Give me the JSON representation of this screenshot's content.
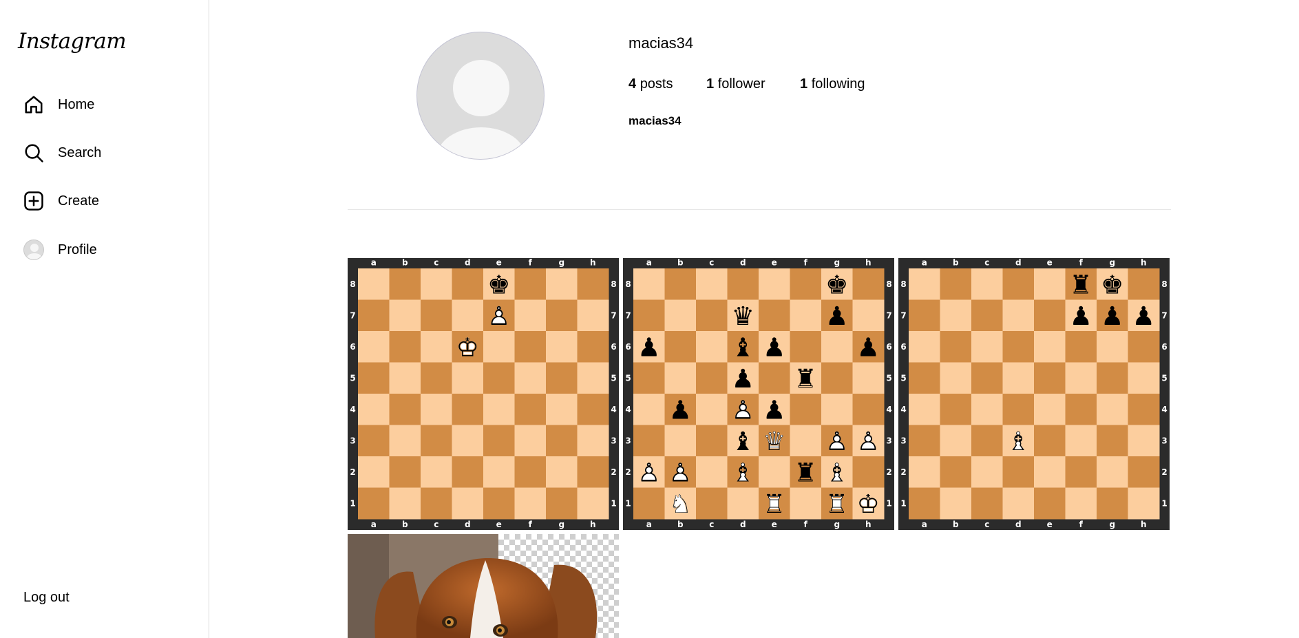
{
  "sidebar": {
    "logo": "Instagram",
    "items": [
      {
        "label": "Home",
        "icon": "home-icon"
      },
      {
        "label": "Search",
        "icon": "search-icon"
      },
      {
        "label": "Create",
        "icon": "plus-square-icon"
      },
      {
        "label": "Profile",
        "icon": "avatar"
      }
    ],
    "logout": "Log out"
  },
  "profile": {
    "username": "macias34",
    "posts_count": "4",
    "posts_label": "posts",
    "followers_count": "1",
    "followers_label": "follower",
    "following_count": "1",
    "following_label": "following",
    "full_name": "macias34"
  },
  "posts": [
    {
      "type": "chess-board",
      "files": [
        "a",
        "b",
        "c",
        "d",
        "e",
        "f",
        "g",
        "h"
      ],
      "ranks": [
        "8",
        "7",
        "6",
        "5",
        "4",
        "3",
        "2",
        "1"
      ],
      "pieces": [
        {
          "square": "e8",
          "piece": "k"
        },
        {
          "square": "e7",
          "piece": "P"
        },
        {
          "square": "d6",
          "piece": "K"
        }
      ]
    },
    {
      "type": "chess-board",
      "files": [
        "a",
        "b",
        "c",
        "d",
        "e",
        "f",
        "g",
        "h"
      ],
      "ranks": [
        "8",
        "7",
        "6",
        "5",
        "4",
        "3",
        "2",
        "1"
      ],
      "pieces": [
        {
          "square": "g8",
          "piece": "k"
        },
        {
          "square": "d7",
          "piece": "q"
        },
        {
          "square": "g7",
          "piece": "p"
        },
        {
          "square": "a6",
          "piece": "p"
        },
        {
          "square": "d6",
          "piece": "b"
        },
        {
          "square": "e6",
          "piece": "p"
        },
        {
          "square": "h6",
          "piece": "p"
        },
        {
          "square": "d5",
          "piece": "p"
        },
        {
          "square": "f5",
          "piece": "r"
        },
        {
          "square": "b4",
          "piece": "p"
        },
        {
          "square": "d4",
          "piece": "P"
        },
        {
          "square": "e4",
          "piece": "p"
        },
        {
          "square": "d3",
          "piece": "b"
        },
        {
          "square": "e3",
          "piece": "Q"
        },
        {
          "square": "g3",
          "piece": "P"
        },
        {
          "square": "h3",
          "piece": "P"
        },
        {
          "square": "a2",
          "piece": "P"
        },
        {
          "square": "b2",
          "piece": "P"
        },
        {
          "square": "d2",
          "piece": "B"
        },
        {
          "square": "f2",
          "piece": "r"
        },
        {
          "square": "g2",
          "piece": "B"
        },
        {
          "square": "b1",
          "piece": "N"
        },
        {
          "square": "e1",
          "piece": "R"
        },
        {
          "square": "g1",
          "piece": "R"
        },
        {
          "square": "h1",
          "piece": "K"
        }
      ]
    },
    {
      "type": "chess-board",
      "files": [
        "a",
        "b",
        "c",
        "d",
        "e",
        "f",
        "g",
        "h"
      ],
      "ranks": [
        "8",
        "7",
        "6",
        "5",
        "4",
        "3",
        "2",
        "1"
      ],
      "pieces": [
        {
          "square": "f8",
          "piece": "r"
        },
        {
          "square": "g8",
          "piece": "k"
        },
        {
          "square": "f7",
          "piece": "p"
        },
        {
          "square": "g7",
          "piece": "p"
        },
        {
          "square": "h7",
          "piece": "p"
        },
        {
          "square": "d3",
          "piece": "B"
        }
      ]
    },
    {
      "type": "photo",
      "subject": "dog"
    }
  ],
  "colors": {
    "light_square": "#fcce9e",
    "dark_square": "#d28c45",
    "board_border": "#2b2b2b"
  }
}
